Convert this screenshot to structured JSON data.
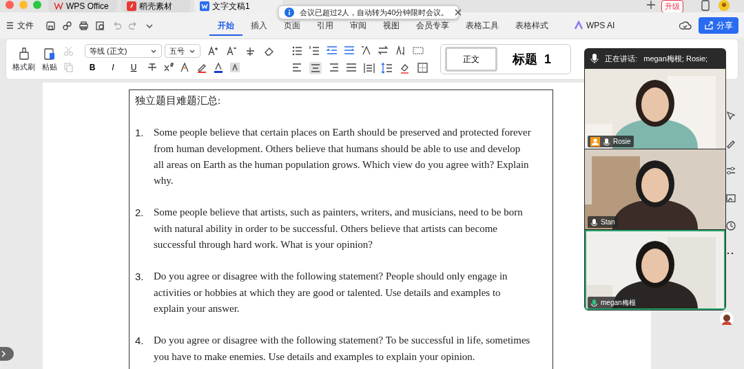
{
  "app_tabs": [
    {
      "label": "WPS Office",
      "selected": false
    },
    {
      "label": "稻壳素材",
      "selected": false
    },
    {
      "label": "文字文稿1",
      "selected": true
    }
  ],
  "upgrade": "升级",
  "toast": {
    "text": "会议已超过2人，自动转为40分钟限时会议。"
  },
  "file_menu": "文件",
  "ribbon_tabs": [
    {
      "label": "开始",
      "selected": true
    },
    {
      "label": "插入",
      "selected": false
    },
    {
      "label": "页面",
      "selected": false
    },
    {
      "label": "引用",
      "selected": false
    },
    {
      "label": "审阅",
      "selected": false
    },
    {
      "label": "视图",
      "selected": false
    },
    {
      "label": "会员专享",
      "selected": false
    },
    {
      "label": "表格工具",
      "selected": false
    },
    {
      "label": "表格样式",
      "selected": false
    }
  ],
  "wps_ai": "WPS AI",
  "share": "分享",
  "ribbon": {
    "format_painter": "格式刷",
    "paste": "粘贴",
    "font": "等线 (正文)",
    "size": "五号",
    "format_glyphs": [
      "B",
      "I",
      "U"
    ],
    "styles": [
      {
        "label": "正文",
        "selected": true
      },
      {
        "label": "标题  1",
        "selected": false
      }
    ]
  },
  "document": {
    "heading": "独立题目难题汇总:",
    "questions": [
      {
        "number": "1.",
        "text": "Some people believe that certain places on Earth should be preserved and protected forever from human development. Others believe that humans should be able to use and develop all areas on Earth as the human population grows. Which view do you agree with? Explain why."
      },
      {
        "number": "2.",
        "text": "Some people believe that artists, such as painters, writers, and musicians, need to be born with natural ability in order to be successful. Others believe that artists can become successful through hard work. What is your opinion?"
      },
      {
        "number": "3.",
        "text": "Do you agree or disagree with the following statement? People should only engage in activities or hobbies at which they are good or talented. Use details and examples to explain your answer."
      },
      {
        "number": "4.",
        "text": "Do you agree or disagree with the following statement? To be successful in life, sometimes you have to make enemies. Use details and examples to explain your opinion."
      }
    ]
  },
  "meeting": {
    "speaking": "正在讲话:   megan梅根; Rosie;",
    "participants": [
      {
        "name": "Rosie",
        "host": true,
        "active": false
      },
      {
        "name": "Stan",
        "host": false,
        "active": false
      },
      {
        "name": "megan梅根",
        "host": false,
        "active": true
      }
    ]
  }
}
